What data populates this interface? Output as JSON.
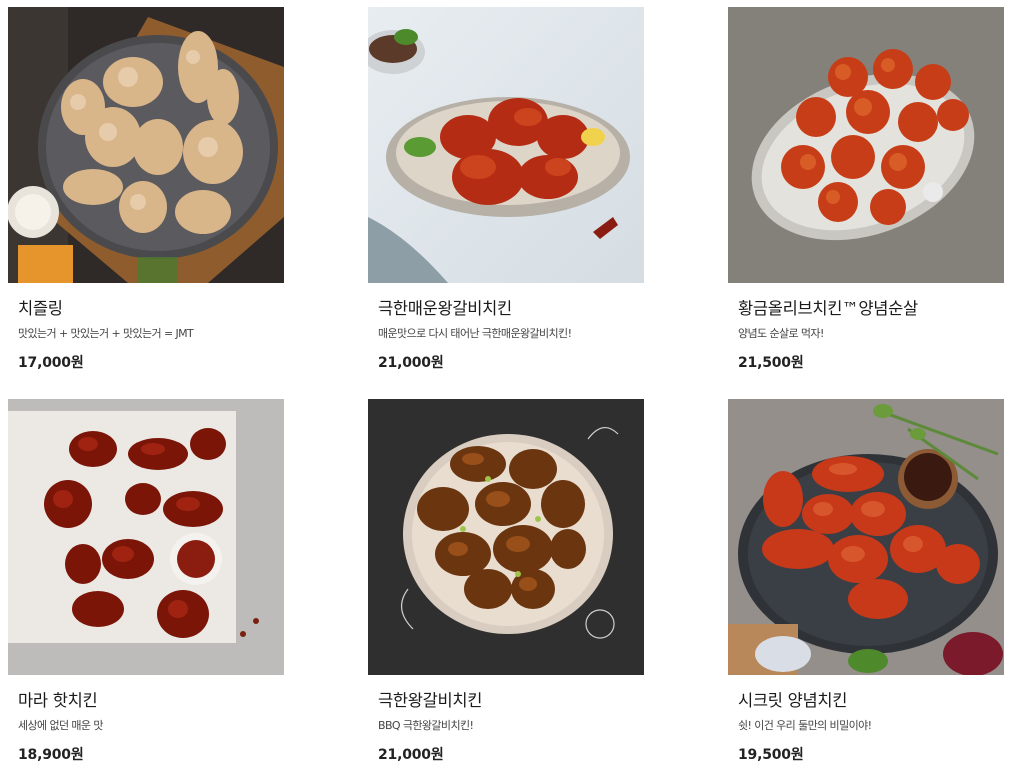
{
  "products": [
    {
      "name": "치즐링",
      "description": "맛있는거 + 맛있는거 + 맛있는거 = JMT",
      "price": "17,000원",
      "image": "fried-chicken-cheese-powder-image"
    },
    {
      "name": "극한매운왕갈비치킨",
      "description": "매운맛으로 다시 태어난 극한매운왕갈비치킨!",
      "price": "21,000원",
      "image": "spicy-galbi-chicken-image"
    },
    {
      "name": "황금올리브치킨™양념순살",
      "description": "양념도 순살로 먹자!",
      "price": "21,500원",
      "image": "boneless-yangnyeom-chicken-image"
    },
    {
      "name": "마라 핫치킨",
      "description": "세상에 없던 매운 맛",
      "price": "18,900원",
      "image": "mala-hot-chicken-image"
    },
    {
      "name": "극한왕갈비치킨",
      "description": "BBQ 극한왕갈비치킨!",
      "price": "21,000원",
      "image": "galbi-chicken-image"
    },
    {
      "name": "시크릿 양념치킨",
      "description": "쉿! 이건 우리 둘만의 비밀이야!",
      "price": "19,500원",
      "image": "secret-yangnyeom-chicken-image"
    }
  ],
  "colors": {
    "price_text": "#222222",
    "name_text": "#1a1a1a",
    "description_text": "#444444"
  }
}
